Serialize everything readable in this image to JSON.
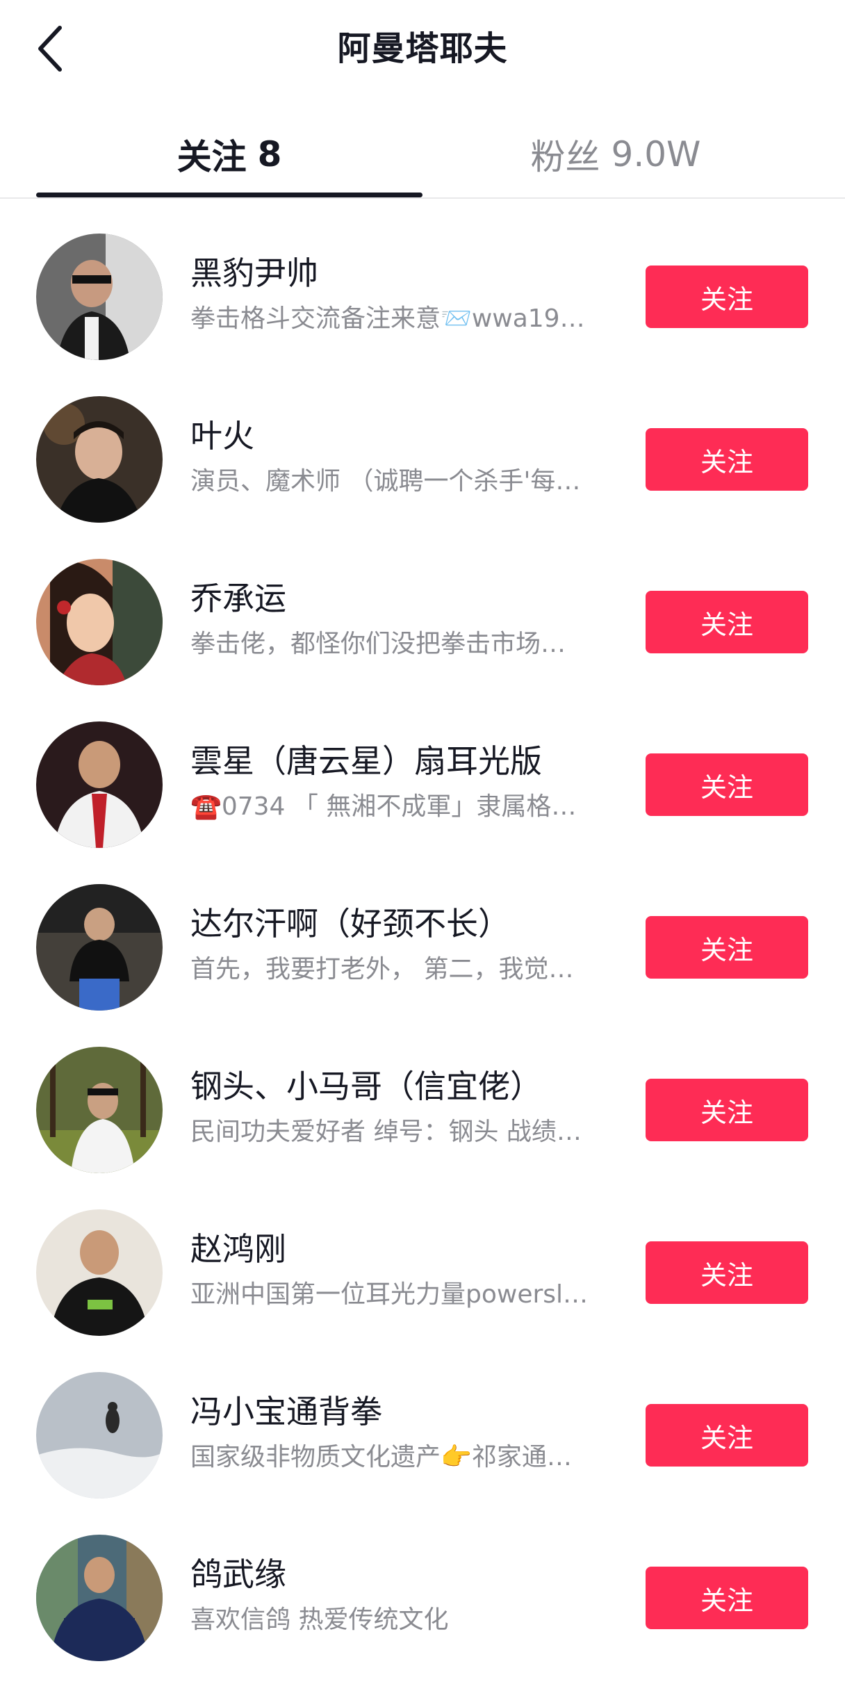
{
  "header": {
    "title": "阿曼塔耶夫",
    "back_icon": "chevron-left-icon"
  },
  "tabs": [
    {
      "label": "关注",
      "count": "8",
      "active": true
    },
    {
      "label": "粉丝",
      "count": "9.0W",
      "active": false
    }
  ],
  "colors": {
    "accent": "#fe2c55",
    "text_primary": "#161823",
    "text_secondary": "#8a8b91"
  },
  "users": [
    {
      "name": "黑豹尹帅",
      "bio": "拳击格斗交流备注来意📨wwa19…",
      "button": "关注",
      "avatar_color": "#6b6b6b"
    },
    {
      "name": "叶火",
      "bio": "演员、魔术师 （诚聘一个杀手'每…",
      "button": "关注",
      "avatar_color": "#3a3028"
    },
    {
      "name": "乔承运",
      "bio": "拳击佬，都怪你们没把拳击市场…",
      "button": "关注",
      "avatar_color": "#c98b6a"
    },
    {
      "name": "雲星（唐云星）扇耳光版",
      "bio": "☎️0734 「 無湘不成軍」隶属格…",
      "button": "关注",
      "avatar_color": "#2a1a1c"
    },
    {
      "name": "达尔汗啊（好颈不长）",
      "bio": "首先，我要打老外， 第二，我觉…",
      "button": "关注",
      "avatar_color": "#44403a"
    },
    {
      "name": "钢头、小马哥（信宜佬）",
      "bio": "民间功夫爱好者 绰号：钢头 战绩…",
      "button": "关注",
      "avatar_color": "#5f6a3a"
    },
    {
      "name": "赵鸿刚",
      "bio": "亚洲中国第一位耳光力量powersl…",
      "button": "关注",
      "avatar_color": "#e9e4dc"
    },
    {
      "name": "冯小宝通背拳",
      "bio": "国家级非物质文化遗产👉祁家通…",
      "button": "关注",
      "avatar_color": "#b9c0c8"
    },
    {
      "name": "鸽武缘",
      "bio": "喜欢信鸽 热爱传统文化",
      "button": "关注",
      "avatar_color": "#4c6a78"
    }
  ]
}
